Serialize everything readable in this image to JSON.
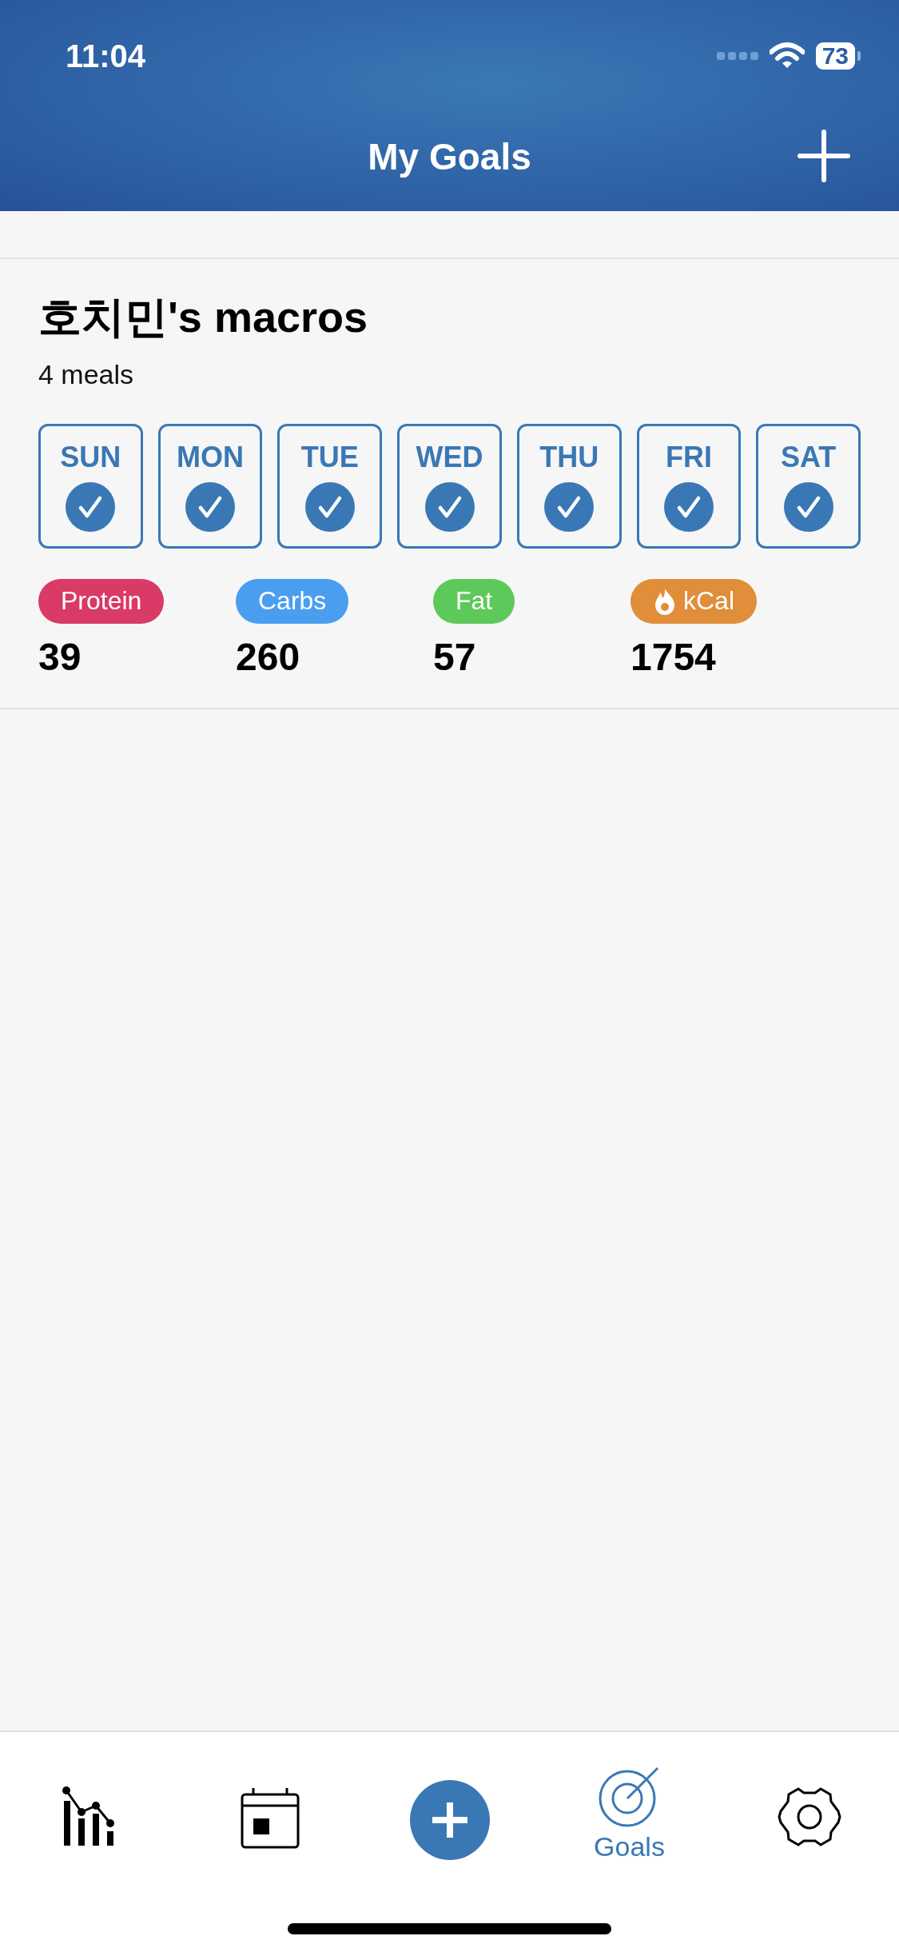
{
  "status_bar": {
    "time": "11:04",
    "battery": "73"
  },
  "header": {
    "title": "My Goals"
  },
  "goal": {
    "title": "호치민's macros",
    "subtitle": "4 meals",
    "days": [
      {
        "label": "SUN",
        "checked": true
      },
      {
        "label": "MON",
        "checked": true
      },
      {
        "label": "TUE",
        "checked": true
      },
      {
        "label": "WED",
        "checked": true
      },
      {
        "label": "THU",
        "checked": true
      },
      {
        "label": "FRI",
        "checked": true
      },
      {
        "label": "SAT",
        "checked": true
      }
    ],
    "macros": [
      {
        "kind": "plain",
        "label": "Protein",
        "color": "#d93a66",
        "value": "39"
      },
      {
        "kind": "plain",
        "label": "Carbs",
        "color": "#4a9ef0",
        "value": "260"
      },
      {
        "kind": "plain",
        "label": "Fat",
        "color": "#5dc95a",
        "value": "57"
      },
      {
        "kind": "calories",
        "label": "kCal",
        "color": "#e08e3a",
        "value": "1754"
      }
    ]
  },
  "tab_bar": [
    {
      "kind": "stats",
      "selected": false
    },
    {
      "kind": "calendar",
      "selected": false
    },
    {
      "kind": "add",
      "selected": false
    },
    {
      "kind": "goals",
      "label": "Goals",
      "selected": true
    },
    {
      "kind": "settings",
      "selected": false
    }
  ]
}
